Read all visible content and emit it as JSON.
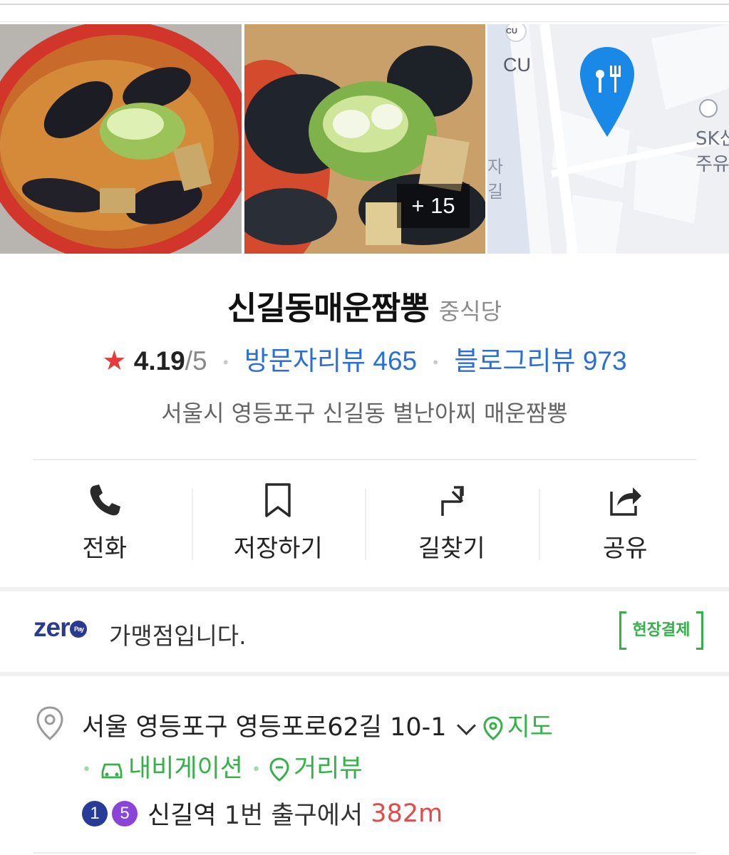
{
  "photos": {
    "more_count": "+ 15"
  },
  "map": {
    "label_cu_badge": "CU",
    "label_cu": "CU",
    "label_station": "SK신길",
    "label_station2": "주유",
    "label_street": "자",
    "label_street2": "길"
  },
  "place": {
    "name": "신길동매운짬뽕",
    "category": "중식당",
    "rating": "4.19",
    "rating_max": "/5",
    "visitor_reviews": "방문자리뷰 465",
    "blog_reviews": "블로그리뷰 973",
    "description": "서울시 영등포구 신길동 별난아찌 매운짬뽕"
  },
  "actions": [
    {
      "label": "전화",
      "icon": "phone-icon"
    },
    {
      "label": "저장하기",
      "icon": "bookmark-icon"
    },
    {
      "label": "길찾기",
      "icon": "directions-icon"
    },
    {
      "label": "공유",
      "icon": "share-icon"
    }
  ],
  "zeropay": {
    "logo": "zer",
    "pay": "Pay",
    "text": "가맹점입니다.",
    "badge": "현장결제"
  },
  "address": {
    "line": "서울 영등포구 영등포로62길 10-1",
    "map_link": "지도",
    "navigation": "내비게이션",
    "street_view": "거리뷰",
    "subway_lines": [
      "1",
      "5"
    ],
    "subway_colors": [
      "#263c96",
      "#8a44d8"
    ],
    "station": "신길역",
    "exit": "1번 출구에서",
    "distance": "382m"
  },
  "colors": {
    "accent_blue": "#2a6fd6",
    "accent_green": "#35b14a",
    "star_red": "#e53b3b"
  }
}
